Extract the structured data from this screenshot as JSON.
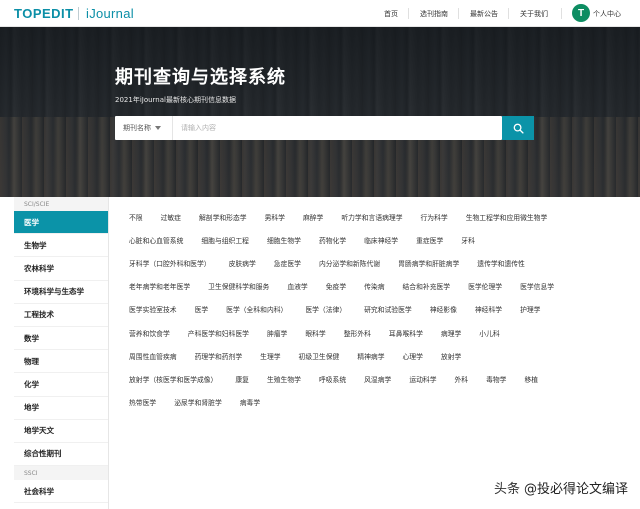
{
  "header": {
    "logo": "TOPEDIT",
    "logo2": "iJournal",
    "nav": [
      "首页",
      "选刊指南",
      "最新公告",
      "关于我们"
    ],
    "avatar_letter": "T",
    "user_center": "个人中心"
  },
  "hero": {
    "title": "期刊查询与选择系统",
    "subtitle": "2021年iJournal最新核心期刊信息数据",
    "search": {
      "category": "期刊名称",
      "placeholder": "请输入内容"
    }
  },
  "sidebar": {
    "group1": "SCI/SCIE",
    "items1": [
      "医学",
      "生物学",
      "农林科学",
      "环境科学与生态学",
      "工程技术",
      "数学",
      "物理",
      "化学",
      "地学",
      "地学天文",
      "综合性期刊"
    ],
    "group2": "SSCI",
    "items2": [
      "社会科学"
    ]
  },
  "subjects": [
    [
      "不限",
      "过敏症",
      "解剖学和形态学",
      "男科学",
      "麻醉学",
      "听力学和言语病理学",
      "行为科学",
      "生物工程学和应用微生物学"
    ],
    [
      "心脏和心血管系统",
      "细胞与组织工程",
      "细胞生物学",
      "药物化学",
      "临床神经学",
      "重症医学",
      "牙科"
    ],
    [
      "牙科学（口腔外科和医学）",
      "皮肤病学",
      "急症医学",
      "内分泌学和新陈代谢",
      "胃肠病学和肝脏病学",
      "遗传学和遗传性"
    ],
    [
      "老年病学和老年医学",
      "卫生保健科学和服务",
      "血液学",
      "免疫学",
      "传染病",
      "结合和补充医学",
      "医学伦理学",
      "医学信息学"
    ],
    [
      "医学实验室技术",
      "医学",
      "医学（全科和内科）",
      "医学（法律）",
      "研究和试验医学",
      "神经影像",
      "神经科学",
      "护理学"
    ],
    [
      "营养和饮食学",
      "产科医学和妇科医学",
      "肿瘤学",
      "眼科学",
      "整形外科",
      "耳鼻喉科学",
      "病理学",
      "小儿科"
    ],
    [
      "周围性血管疾病",
      "药理学和药剂学",
      "生理学",
      "初级卫生保健",
      "精神病学",
      "心理学",
      "放射学"
    ],
    [
      "放射学（核医学和医学成像）",
      "康复",
      "生殖生物学",
      "呼吸系统",
      "风湿病学",
      "运动科学",
      "外科",
      "毒物学",
      "移植"
    ],
    [
      "热带医学",
      "泌尿学和肾脏学",
      "病毒学"
    ]
  ],
  "watermark": {
    "prefix": "头条",
    "text": "@投必得论文编译"
  },
  "colors": {
    "accent": "#0b93a8",
    "brand": "#0b8fa7",
    "avatar": "#0d8d62"
  }
}
